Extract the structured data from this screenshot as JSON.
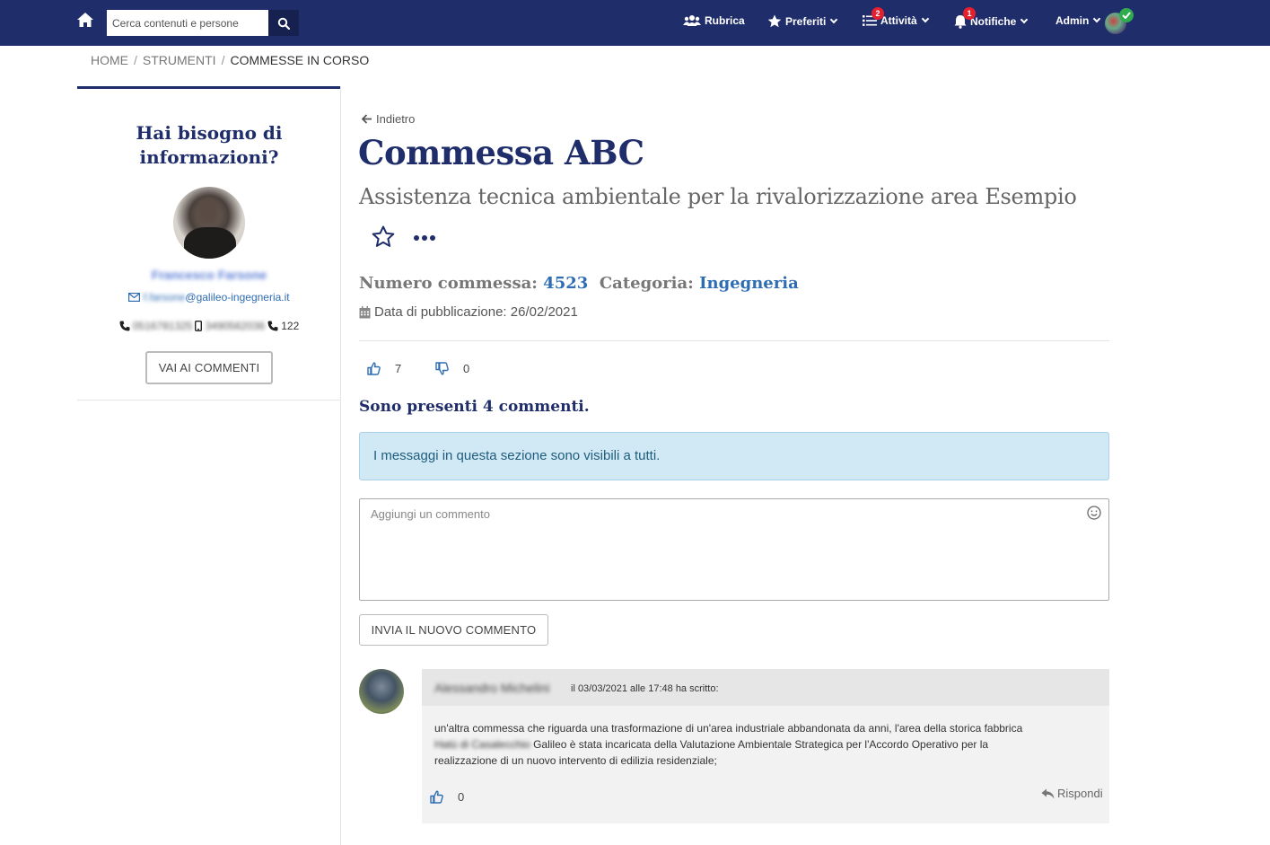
{
  "topbar": {
    "search_placeholder": "Cerca contenuti e persone",
    "nav": {
      "rubrica": "Rubrica",
      "preferiti": "Preferiti",
      "attivita": "Attività",
      "attivita_badge": "2",
      "notifiche": "Notifiche",
      "notifiche_badge": "1",
      "admin": "Admin"
    },
    "icons": [
      "home-icon",
      "search-icon",
      "users-icon",
      "star-icon",
      "list-icon",
      "bell-icon",
      "chevron-down-icon",
      "check-icon"
    ]
  },
  "breadcrumb": [
    "HOME",
    "STRUMENTI",
    "COMMESSE IN CORSO"
  ],
  "sidebar": {
    "title": "Hai bisogno di informazioni?",
    "contact_name": "Francesco Farsone",
    "email_user": "f.farsone",
    "email_domain": "@galileo-ingegneria.it",
    "phone": "0516781325",
    "mobile": "3490562036",
    "extension": "122",
    "comments_button": "VAI AI COMMENTI"
  },
  "main": {
    "back": "Indietro",
    "title": "Commessa ABC",
    "subtitle": "Assistenza tecnica ambientale per la rivalorizzazione area Esempio",
    "numero_label": "Numero commessa:",
    "numero_value": "4523",
    "categoria_label": "Categoria:",
    "categoria_value": "Ingegneria",
    "pubdate": "Data di pubblicazione: 26/02/2021",
    "likes": "7",
    "dislikes": "0",
    "comments_count": "Sono presenti 4 commenti.",
    "alert": "I messaggi in questa sezione sono visibili a tutti.",
    "comment_placeholder": "Aggiungi un commento",
    "submit_button": "INVIA IL NUOVO COMMENTO"
  },
  "comment": {
    "author": "Alessandro Michelini",
    "when": "il 03/03/2021 alle 17:48 ha scritto:",
    "body_1": "un'altra commessa che riguarda una trasformazione di un'area industriale abbandonata da anni, l'area della storica fabbrica",
    "body_2_blur": "Hatù di Casalecchio",
    "body_2": " Galileo è stata incaricata della Valutazione Ambientale Strategica per l'Accordo Operativo per la",
    "body_3": "realizzazione di un nuovo intervento di edilizia residenziale;",
    "likes": "0",
    "reply": "Rispondi"
  },
  "colors": {
    "navy": "#1f2d6b",
    "link_blue": "#2e6db4",
    "badge_red": "#e5202e",
    "online_green": "#2eac4e",
    "alert_bg": "#d1e8f5"
  }
}
